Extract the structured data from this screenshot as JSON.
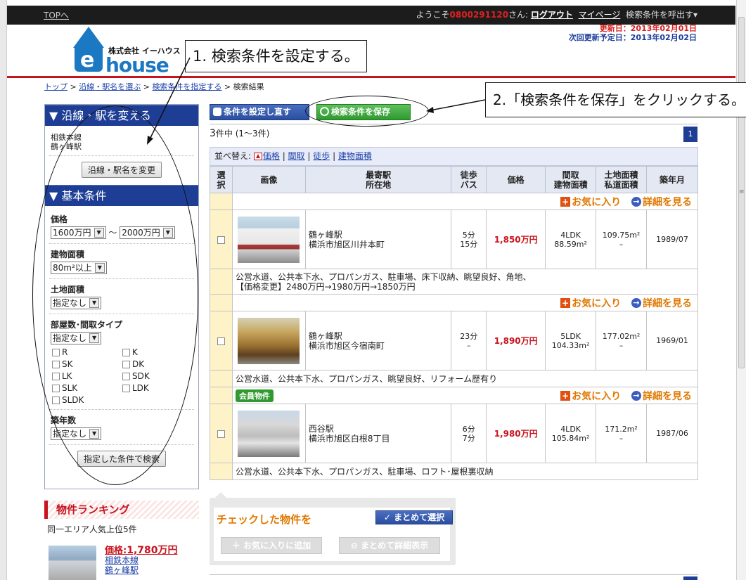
{
  "topbar": {
    "top_link": "TOPへ",
    "welcome_prefix": "ようこそ",
    "user_id": "0800291120",
    "welcome_suffix": "さん: ",
    "logout": "ログアウト",
    "mypage": "マイページ",
    "recall": "検索条件を呼出す▾"
  },
  "update": {
    "updated": "更新日：2013年02月01日",
    "next": "次回更新予定日：2013年02月02日"
  },
  "logo": {
    "company": "株式会社 イーハウス",
    "e": "e",
    "word": "house"
  },
  "breadcrumb": {
    "items": [
      "トップ",
      "沿線・駅名を選ぶ",
      "検索条件を指定する"
    ],
    "current": "検索結果",
    "sep": " > "
  },
  "callouts": {
    "step1": "1. 検索条件を設定する。",
    "step2": "2.「検索条件を保存」をクリックする。"
  },
  "sidebar": {
    "line_head": "▼ 沿線・駅を変える",
    "line_name": "相鉄本線",
    "station": "鶴ヶ峰駅",
    "change_button": "沿線・駅名を変更",
    "basic_head": "▼ 基本条件",
    "price_label": "価格",
    "price_min": "1600万円",
    "price_sep": "〜",
    "price_max": "2000万円",
    "bldg_label": "建物面積",
    "bldg_value": "80m²以上",
    "land_label": "土地面積",
    "land_value": "指定なし",
    "rooms_label": "部屋数･間取タイプ",
    "rooms_value": "指定なし",
    "room_types": [
      "R",
      "K",
      "SK",
      "DK",
      "LK",
      "SDK",
      "SLK",
      "LDK",
      "SLDK"
    ],
    "age_label": "築年数",
    "age_value": "指定なし",
    "search_button": "指定した条件で検索"
  },
  "ranking": {
    "title": "物件ランキング",
    "subtitle": "同一エリア人気上位5件",
    "price_prefix": "価格:",
    "price": "1,780万円",
    "line": "相鉄本線",
    "station": "鶴ヶ峰駅"
  },
  "results": {
    "reset_button": "条件を設定し直す",
    "save_button": "検索条件を保存",
    "count": "3",
    "count_suffix": "件中 (1〜3件)",
    "page": "1",
    "sort_label": "並べ替え: ",
    "sort_options": [
      "価格",
      "間取",
      "徒歩",
      "建物面積"
    ],
    "headers": [
      "選択",
      "画像",
      "最寄駅\n所在地",
      "徒歩\nバス",
      "価格",
      "間取\n建物面積",
      "土地面積\n私道面積",
      "築年月"
    ],
    "favorite": "お気に入り",
    "detail": "詳細を見る",
    "member_badge": "会員物件",
    "rows": [
      {
        "station": "鶴ヶ峰駅",
        "address": "横浜市旭区川井本町",
        "walk": "5分",
        "bus": "15分",
        "price": "1,850万円",
        "layout": "4LDK",
        "bldg_area": "88.59m²",
        "land_area": "109.75m²",
        "private_road": "–",
        "built": "1989/07",
        "features": "公営水道、公共本下水、プロパンガス、駐車場、床下収納、眺望良好、角地、",
        "note": "【価格変更】2480万円→1980万円→1850万円",
        "member": false
      },
      {
        "station": "鶴ヶ峰駅",
        "address": "横浜市旭区今宿南町",
        "walk": "23分",
        "bus": "–",
        "price": "1,890万円",
        "layout": "5LDK",
        "bldg_area": "104.33m²",
        "land_area": "177.02m²",
        "private_road": "–",
        "built": "1969/01",
        "features": "公営水道、公共本下水、プロパンガス、眺望良好、リフォーム歴有り",
        "note": "",
        "member": false
      },
      {
        "station": "西谷駅",
        "address": "横浜市旭区白根8丁目",
        "walk": "6分",
        "bus": "7分",
        "price": "1,980万円",
        "layout": "4LDK",
        "bldg_area": "105.84m²",
        "land_area": "171.2m²",
        "private_road": "–",
        "built": "1987/06",
        "features": "公営水道、公共本下水、プロパンガス、駐車場、ロフト･屋根裏収納",
        "note": "",
        "member": true
      }
    ]
  },
  "bulk": {
    "title": "チェックした物件を",
    "select_all": "まとめて選択",
    "add_fav": "お気に入りに追加",
    "show_detail": "まとめて詳細表示"
  }
}
